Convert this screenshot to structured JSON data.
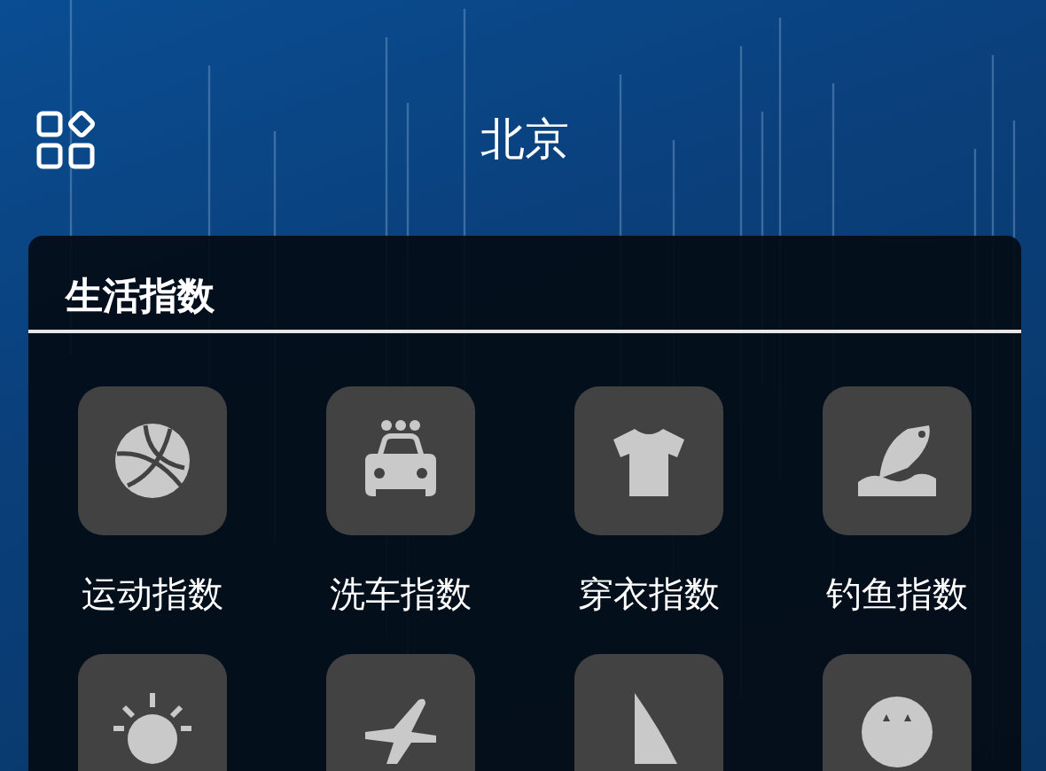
{
  "header": {
    "title": "北京"
  },
  "card": {
    "title": "生活指数",
    "items": [
      {
        "kind": "basketball",
        "label": "运动指数"
      },
      {
        "kind": "car",
        "label": "洗车指数"
      },
      {
        "kind": "shirt",
        "label": "穿衣指数"
      },
      {
        "kind": "fish",
        "label": "钓鱼指数"
      },
      {
        "kind": "sun"
      },
      {
        "kind": "airplane"
      },
      {
        "kind": "sail"
      },
      {
        "kind": "face"
      }
    ]
  }
}
